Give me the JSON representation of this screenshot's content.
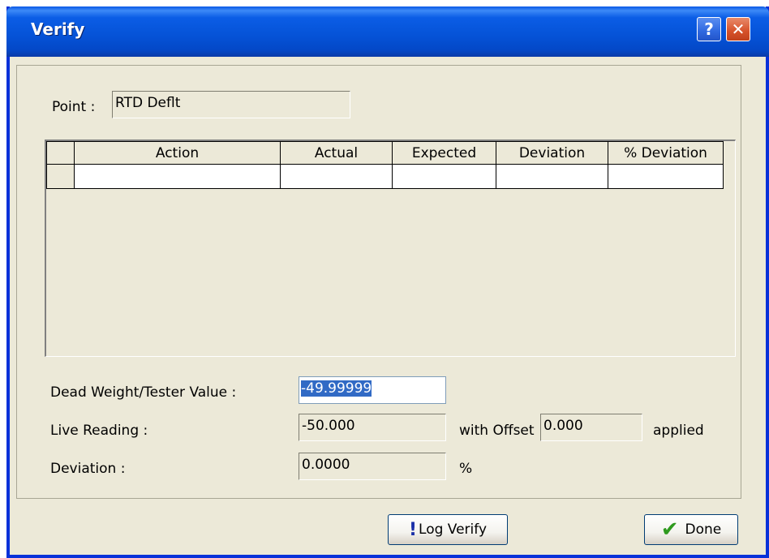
{
  "window": {
    "title": "Verify"
  },
  "point": {
    "label": "Point :",
    "value": "RTD Deflt"
  },
  "table": {
    "columns": [
      "Action",
      "Actual",
      "Expected",
      "Deviation",
      "% Deviation"
    ]
  },
  "deadweight": {
    "label": "Dead Weight/Tester Value :",
    "value": "-49.99999"
  },
  "live": {
    "label": "Live Reading :",
    "value": "-50.000",
    "offset_label": "with Offset",
    "offset_value": "0.000",
    "applied_label": "applied"
  },
  "deviation": {
    "label": "Deviation :",
    "value": "0.0000",
    "unit": "%"
  },
  "buttons": {
    "log_verify": "Log Verify",
    "done": "Done"
  },
  "icons": {
    "help": "help-icon",
    "close": "close-icon",
    "log": "exclamation-icon",
    "done": "checkmark-icon"
  }
}
